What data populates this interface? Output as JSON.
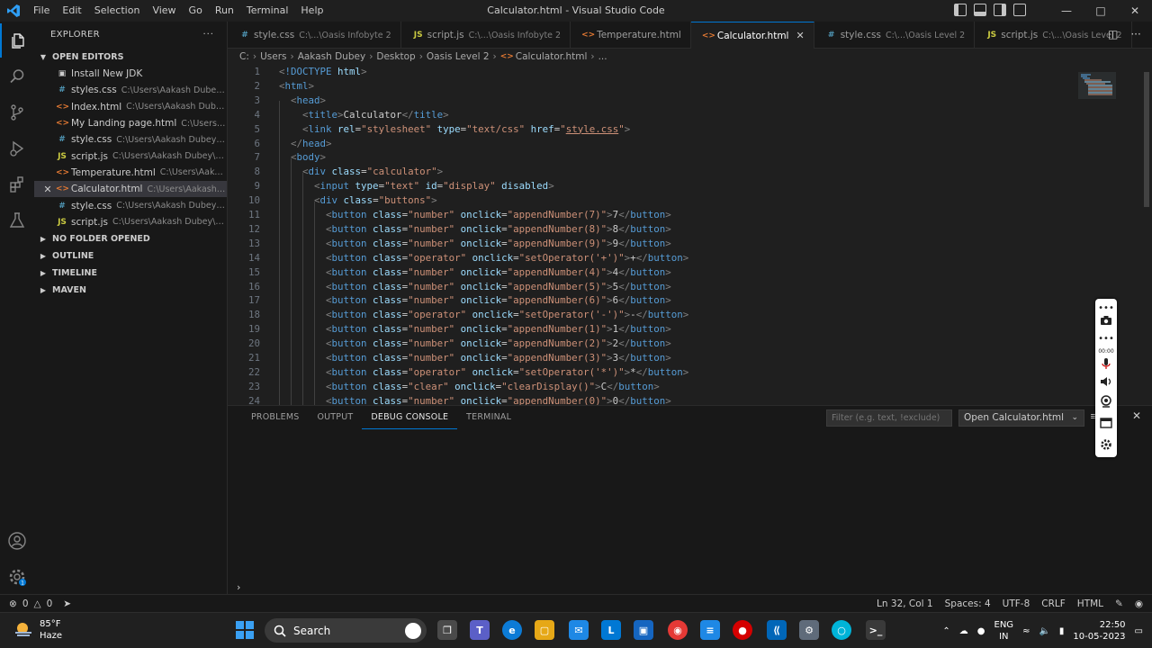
{
  "window": {
    "title": "Calculator.html - Visual Studio Code",
    "menu": [
      "File",
      "Edit",
      "Selection",
      "View",
      "Go",
      "Run",
      "Terminal",
      "Help"
    ]
  },
  "explorer": {
    "title": "EXPLORER",
    "open_editors_label": "OPEN EDITORS",
    "open_editors": [
      {
        "icon": "jdk",
        "name": "Install New JDK",
        "path": ""
      },
      {
        "icon": "css",
        "name": "styles.css",
        "path": "C:\\Users\\Aakash Dubey\\..."
      },
      {
        "icon": "html",
        "name": "Index.html",
        "path": "C:\\Users\\Aakash Dube..."
      },
      {
        "icon": "html",
        "name": "My Landing page.html",
        "path": "C:\\Users\\..."
      },
      {
        "icon": "css",
        "name": "style.css",
        "path": "C:\\Users\\Aakash Dubey\\..."
      },
      {
        "icon": "js",
        "name": "script.js",
        "path": "C:\\Users\\Aakash Dubey\\D..."
      },
      {
        "icon": "html",
        "name": "Temperature.html",
        "path": "C:\\Users\\Aaka..."
      },
      {
        "icon": "html",
        "name": "Calculator.html",
        "path": "C:\\Users\\Aakash ..."
      },
      {
        "icon": "css",
        "name": "style.css",
        "path": "C:\\Users\\Aakash Dubey\\..."
      },
      {
        "icon": "js",
        "name": "script.js",
        "path": "C:\\Users\\Aakash Dubey\\D..."
      }
    ],
    "sections": [
      "NO FOLDER OPENED",
      "OUTLINE",
      "TIMELINE",
      "MAVEN"
    ]
  },
  "tabs": [
    {
      "icon": "css",
      "name": "style.css",
      "path": "C:\\...\\Oasis Infobyte 2"
    },
    {
      "icon": "js",
      "name": "script.js",
      "path": "C:\\...\\Oasis Infobyte 2"
    },
    {
      "icon": "html",
      "name": "Temperature.html",
      "path": ""
    },
    {
      "icon": "html",
      "name": "Calculator.html",
      "path": ""
    },
    {
      "icon": "css",
      "name": "style.css",
      "path": "C:\\...\\Oasis Level 2"
    },
    {
      "icon": "js",
      "name": "script.js",
      "path": "C:\\...\\Oasis Level 2"
    }
  ],
  "breadcrumb": [
    "C:",
    "Users",
    "Aakash Dubey",
    "Desktop",
    "Oasis Level 2",
    "Calculator.html",
    "..."
  ],
  "code_lines": [
    {
      "n": "1",
      "indent": 0,
      "html": "<span class=\"t\">&lt;</span><span class=\"tn\">!DOCTYPE</span> <span class=\"an\">html</span><span class=\"t\">&gt;</span>"
    },
    {
      "n": "2",
      "indent": 0,
      "html": "<span class=\"t\">&lt;</span><span class=\"tn\">html</span><span class=\"t\">&gt;</span>"
    },
    {
      "n": "3",
      "indent": 1,
      "html": "<span class=\"t\">&lt;</span><span class=\"tn\">head</span><span class=\"t\">&gt;</span>"
    },
    {
      "n": "4",
      "indent": 2,
      "html": "<span class=\"t\">&lt;</span><span class=\"tn\">title</span><span class=\"t\">&gt;</span><span class=\"tx\">Calculator</span><span class=\"t\">&lt;/</span><span class=\"tn\">title</span><span class=\"t\">&gt;</span>"
    },
    {
      "n": "5",
      "indent": 2,
      "html": "<span class=\"t\">&lt;</span><span class=\"tn\">link</span> <span class=\"an\">rel</span><span class=\"eq\">=</span><span class=\"av\">\"stylesheet\"</span> <span class=\"an\">type</span><span class=\"eq\">=</span><span class=\"av\">\"text/css\"</span> <span class=\"an\">href</span><span class=\"eq\">=</span><span class=\"av\">\"<u>style.css</u>\"</span><span class=\"t\">&gt;</span>"
    },
    {
      "n": "6",
      "indent": 1,
      "html": "<span class=\"t\">&lt;/</span><span class=\"tn\">head</span><span class=\"t\">&gt;</span>"
    },
    {
      "n": "7",
      "indent": 1,
      "html": "<span class=\"t\">&lt;</span><span class=\"tn\">body</span><span class=\"t\">&gt;</span>"
    },
    {
      "n": "8",
      "indent": 2,
      "html": "<span class=\"t\">&lt;</span><span class=\"tn\">div</span> <span class=\"an\">class</span><span class=\"eq\">=</span><span class=\"av\">\"calculator\"</span><span class=\"t\">&gt;</span>"
    },
    {
      "n": "9",
      "indent": 3,
      "html": "<span class=\"t\">&lt;</span><span class=\"tn\">input</span> <span class=\"an\">type</span><span class=\"eq\">=</span><span class=\"av\">\"text\"</span> <span class=\"an\">id</span><span class=\"eq\">=</span><span class=\"av\">\"display\"</span> <span class=\"an\">disabled</span><span class=\"t\">&gt;</span>"
    },
    {
      "n": "10",
      "indent": 3,
      "html": "<span class=\"t\">&lt;</span><span class=\"tn\">div</span> <span class=\"an\">class</span><span class=\"eq\">=</span><span class=\"av\">\"buttons\"</span><span class=\"t\">&gt;</span>"
    },
    {
      "n": "11",
      "indent": 4,
      "html": "<span class=\"t\">&lt;</span><span class=\"tn\">button</span> <span class=\"an\">class</span><span class=\"eq\">=</span><span class=\"av\">\"number\"</span> <span class=\"an\">onclick</span><span class=\"eq\">=</span><span class=\"av\">\"appendNumber(7)\"</span><span class=\"t\">&gt;</span><span class=\"tx\">7</span><span class=\"t\">&lt;/</span><span class=\"tn\">button</span><span class=\"t\">&gt;</span>"
    },
    {
      "n": "12",
      "indent": 4,
      "html": "<span class=\"t\">&lt;</span><span class=\"tn\">button</span> <span class=\"an\">class</span><span class=\"eq\">=</span><span class=\"av\">\"number\"</span> <span class=\"an\">onclick</span><span class=\"eq\">=</span><span class=\"av\">\"appendNumber(8)\"</span><span class=\"t\">&gt;</span><span class=\"tx\">8</span><span class=\"t\">&lt;/</span><span class=\"tn\">button</span><span class=\"t\">&gt;</span>"
    },
    {
      "n": "13",
      "indent": 4,
      "html": "<span class=\"t\">&lt;</span><span class=\"tn\">button</span> <span class=\"an\">class</span><span class=\"eq\">=</span><span class=\"av\">\"number\"</span> <span class=\"an\">onclick</span><span class=\"eq\">=</span><span class=\"av\">\"appendNumber(9)\"</span><span class=\"t\">&gt;</span><span class=\"tx\">9</span><span class=\"t\">&lt;/</span><span class=\"tn\">button</span><span class=\"t\">&gt;</span>"
    },
    {
      "n": "14",
      "indent": 4,
      "html": "<span class=\"t\">&lt;</span><span class=\"tn\">button</span> <span class=\"an\">class</span><span class=\"eq\">=</span><span class=\"av\">\"operator\"</span> <span class=\"an\">onclick</span><span class=\"eq\">=</span><span class=\"av\">\"setOperator('+')\"</span><span class=\"t\">&gt;</span><span class=\"tx\">+</span><span class=\"t\">&lt;/</span><span class=\"tn\">button</span><span class=\"t\">&gt;</span>"
    },
    {
      "n": "15",
      "indent": 4,
      "html": "<span class=\"t\">&lt;</span><span class=\"tn\">button</span> <span class=\"an\">class</span><span class=\"eq\">=</span><span class=\"av\">\"number\"</span> <span class=\"an\">onclick</span><span class=\"eq\">=</span><span class=\"av\">\"appendNumber(4)\"</span><span class=\"t\">&gt;</span><span class=\"tx\">4</span><span class=\"t\">&lt;/</span><span class=\"tn\">button</span><span class=\"t\">&gt;</span>"
    },
    {
      "n": "16",
      "indent": 4,
      "html": "<span class=\"t\">&lt;</span><span class=\"tn\">button</span> <span class=\"an\">class</span><span class=\"eq\">=</span><span class=\"av\">\"number\"</span> <span class=\"an\">onclick</span><span class=\"eq\">=</span><span class=\"av\">\"appendNumber(5)\"</span><span class=\"t\">&gt;</span><span class=\"tx\">5</span><span class=\"t\">&lt;/</span><span class=\"tn\">button</span><span class=\"t\">&gt;</span>"
    },
    {
      "n": "17",
      "indent": 4,
      "html": "<span class=\"t\">&lt;</span><span class=\"tn\">button</span> <span class=\"an\">class</span><span class=\"eq\">=</span><span class=\"av\">\"number\"</span> <span class=\"an\">onclick</span><span class=\"eq\">=</span><span class=\"av\">\"appendNumber(6)\"</span><span class=\"t\">&gt;</span><span class=\"tx\">6</span><span class=\"t\">&lt;/</span><span class=\"tn\">button</span><span class=\"t\">&gt;</span>"
    },
    {
      "n": "18",
      "indent": 4,
      "html": "<span class=\"t\">&lt;</span><span class=\"tn\">button</span> <span class=\"an\">class</span><span class=\"eq\">=</span><span class=\"av\">\"operator\"</span> <span class=\"an\">onclick</span><span class=\"eq\">=</span><span class=\"av\">\"setOperator('-')\"</span><span class=\"t\">&gt;</span><span class=\"tx\">-</span><span class=\"t\">&lt;/</span><span class=\"tn\">button</span><span class=\"t\">&gt;</span>"
    },
    {
      "n": "19",
      "indent": 4,
      "html": "<span class=\"t\">&lt;</span><span class=\"tn\">button</span> <span class=\"an\">class</span><span class=\"eq\">=</span><span class=\"av\">\"number\"</span> <span class=\"an\">onclick</span><span class=\"eq\">=</span><span class=\"av\">\"appendNumber(1)\"</span><span class=\"t\">&gt;</span><span class=\"tx\">1</span><span class=\"t\">&lt;/</span><span class=\"tn\">button</span><span class=\"t\">&gt;</span>"
    },
    {
      "n": "20",
      "indent": 4,
      "html": "<span class=\"t\">&lt;</span><span class=\"tn\">button</span> <span class=\"an\">class</span><span class=\"eq\">=</span><span class=\"av\">\"number\"</span> <span class=\"an\">onclick</span><span class=\"eq\">=</span><span class=\"av\">\"appendNumber(2)\"</span><span class=\"t\">&gt;</span><span class=\"tx\">2</span><span class=\"t\">&lt;/</span><span class=\"tn\">button</span><span class=\"t\">&gt;</span>"
    },
    {
      "n": "21",
      "indent": 4,
      "html": "<span class=\"t\">&lt;</span><span class=\"tn\">button</span> <span class=\"an\">class</span><span class=\"eq\">=</span><span class=\"av\">\"number\"</span> <span class=\"an\">onclick</span><span class=\"eq\">=</span><span class=\"av\">\"appendNumber(3)\"</span><span class=\"t\">&gt;</span><span class=\"tx\">3</span><span class=\"t\">&lt;/</span><span class=\"tn\">button</span><span class=\"t\">&gt;</span>"
    },
    {
      "n": "22",
      "indent": 4,
      "html": "<span class=\"t\">&lt;</span><span class=\"tn\">button</span> <span class=\"an\">class</span><span class=\"eq\">=</span><span class=\"av\">\"operator\"</span> <span class=\"an\">onclick</span><span class=\"eq\">=</span><span class=\"av\">\"setOperator('*')\"</span><span class=\"t\">&gt;</span><span class=\"tx\">*</span><span class=\"t\">&lt;/</span><span class=\"tn\">button</span><span class=\"t\">&gt;</span>"
    },
    {
      "n": "23",
      "indent": 4,
      "html": "<span class=\"t\">&lt;</span><span class=\"tn\">button</span> <span class=\"an\">class</span><span class=\"eq\">=</span><span class=\"av\">\"clear\"</span> <span class=\"an\">onclick</span><span class=\"eq\">=</span><span class=\"av\">\"clearDisplay()\"</span><span class=\"t\">&gt;</span><span class=\"tx\">C</span><span class=\"t\">&lt;/</span><span class=\"tn\">button</span><span class=\"t\">&gt;</span>"
    },
    {
      "n": "24",
      "indent": 4,
      "html": "<span class=\"t\">&lt;</span><span class=\"tn\">button</span> <span class=\"an\">class</span><span class=\"eq\">=</span><span class=\"av\">\"number\"</span> <span class=\"an\">onclick</span><span class=\"eq\">=</span><span class=\"av\">\"appendNumber(0)\"</span><span class=\"t\">&gt;</span><span class=\"tx\">0</span><span class=\"t\">&lt;/</span><span class=\"tn\">button</span><span class=\"t\">&gt;</span>"
    }
  ],
  "panel": {
    "tabs": [
      "PROBLEMS",
      "OUTPUT",
      "DEBUG CONSOLE",
      "TERMINAL"
    ],
    "active_tab": "DEBUG CONSOLE",
    "filter_placeholder": "Filter (e.g. text, !exclude)",
    "selected_config": "Open Calculator.html",
    "prompt": "›"
  },
  "statusbar": {
    "errors": "0",
    "warnings": "0",
    "position": "Ln 32, Col 1",
    "spaces": "Spaces: 4",
    "encoding": "UTF-8",
    "eol": "CRLF",
    "language": "HTML"
  },
  "taskbar": {
    "temperature": "85°F",
    "weather": "Haze",
    "search_label": "Search",
    "lang_line1": "ENG",
    "lang_line2": "IN",
    "time": "22:50",
    "date": "10-05-2023"
  },
  "colors": {
    "accent": "#0078d4",
    "editor_bg": "#1f1f1f",
    "sidebar_bg": "#181818"
  }
}
